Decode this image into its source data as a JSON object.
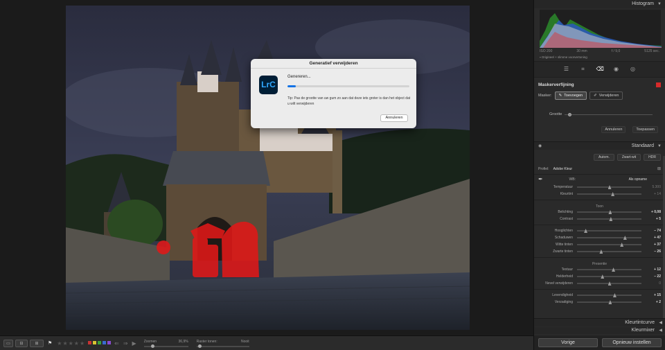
{
  "dialog": {
    "title": "Generatief verwijderen",
    "app_logo": "LrC",
    "status": "Genereren...",
    "progress": 0.07,
    "tip": "Tip: Pas de grootte van uw gum zo aan dat deze iets groter is dan het object dat u wilt verwijderen",
    "cancel_label": "Annuleren"
  },
  "toolbar": {
    "zoom_label": "Zoomen",
    "zoom_value": "36,9%",
    "grid_label": "Raster tonen:",
    "grid_value": "Nooit",
    "stars": "★★★★★",
    "colors": [
      "#c83333",
      "#d8c432",
      "#3aa13a",
      "#3a6bd1",
      "#8a4ad1"
    ]
  },
  "panel": {
    "histogram_title": "Histogram",
    "histo_info": {
      "iso": "ISO 200",
      "focal": "30 mm",
      "aperture": "f / 9,0",
      "shutter": "5125 sec."
    },
    "histo_option": "Origineel + slimme voorvertoning",
    "mask": {
      "title": "Maskerverfijning",
      "mask_label": "Masker:",
      "add_label": "Toevoegen",
      "remove_label": "Verwijderen",
      "size_label": "Grootte",
      "size_level": 0.04,
      "cancel_label": "Annuleren",
      "apply_label": "Toepassen"
    },
    "standard_title": "Standaard",
    "treatments": [
      "Autom.",
      "Zwart-wit",
      "HDR"
    ],
    "profile_label": "Profiel:",
    "profile_value": "Adobe Kleur",
    "wb_label": "WB:",
    "wb_value": "Als opname",
    "basic": [
      {
        "label": "Temperatuur",
        "value": "5.300",
        "pos": 0.5,
        "dim": true
      },
      {
        "label": "Kleurtint",
        "value": "+ 14",
        "pos": 0.55,
        "dim": true
      }
    ],
    "tone_label": "Toon",
    "tone": [
      {
        "label": "Belichting",
        "value": "+ 0,08",
        "pos": 0.51
      },
      {
        "label": "Contrast",
        "value": "+ 5",
        "pos": 0.52
      }
    ],
    "tone2": [
      {
        "label": "Hooglichten",
        "value": "– 74",
        "pos": 0.13
      },
      {
        "label": "Schaduwen",
        "value": "+ 47",
        "pos": 0.74
      },
      {
        "label": "Witte tinten",
        "value": "+ 37",
        "pos": 0.69
      },
      {
        "label": "Zwarte tinten",
        "value": "– 26",
        "pos": 0.37
      }
    ],
    "presence_label": "Presentie",
    "presence": [
      {
        "label": "Textuur",
        "value": "+ 12",
        "pos": 0.56
      },
      {
        "label": "Helderheid",
        "value": "– 22",
        "pos": 0.39
      },
      {
        "label": "Nevel verwijderen",
        "value": "0",
        "pos": 0.5,
        "dim": true
      }
    ],
    "color": [
      {
        "label": "Levendigheid",
        "value": "+ 15",
        "pos": 0.58
      },
      {
        "label": "Verzadiging",
        "value": "+ 2",
        "pos": 0.51
      }
    ],
    "kleurtintcurve_title": "Kleurtintcurve",
    "kleurmixer_title": "Kleurmixer",
    "prev_label": "Vorige",
    "reset_label": "Opnieuw instellen"
  }
}
